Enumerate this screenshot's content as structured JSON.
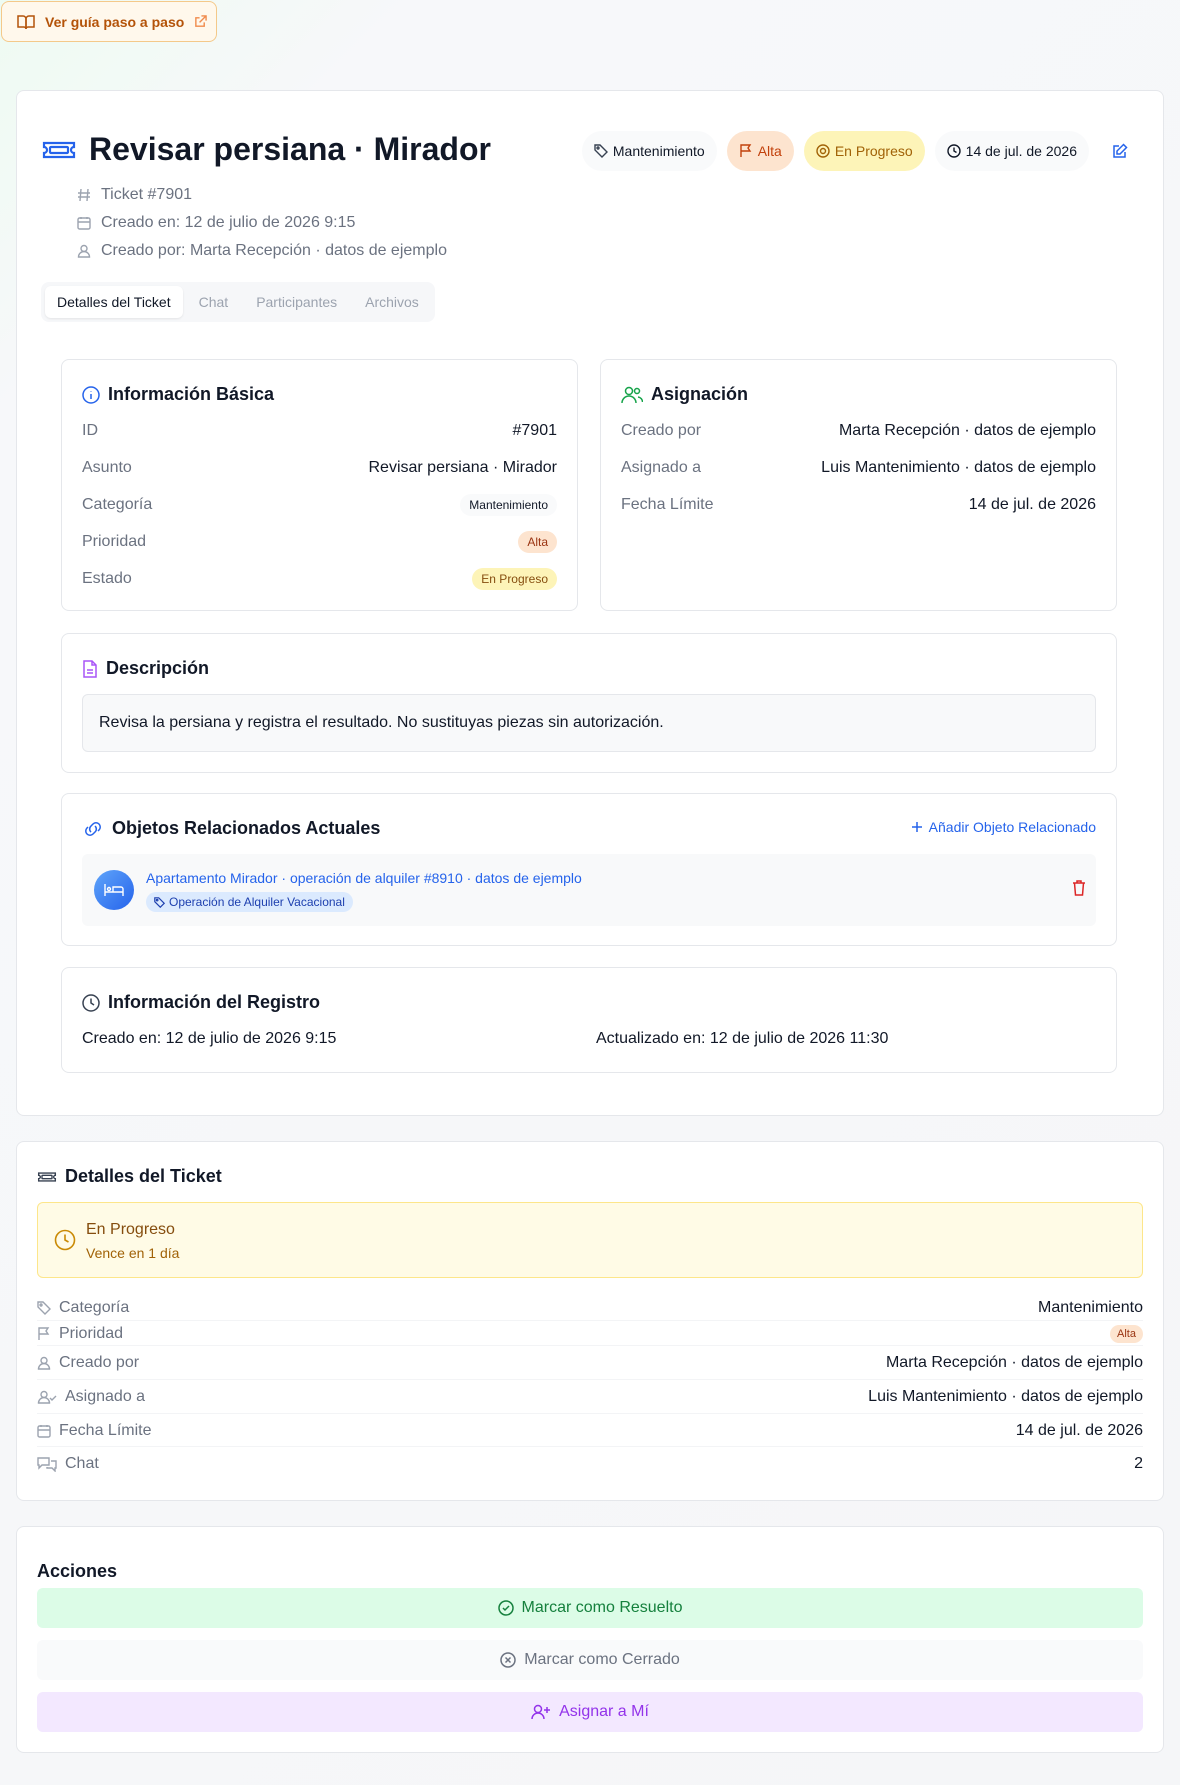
{
  "guide": {
    "label": "Ver guía paso a paso"
  },
  "ticket": {
    "title": "Revisar persiana · Mirador",
    "badges": {
      "category": "Mantenimiento",
      "priority": "Alta",
      "status": "En Progreso",
      "due": "14 de jul. de 2026"
    },
    "meta": {
      "number": "Ticket #7901",
      "created": "Creado en: 12 de julio de 2026 9:15",
      "creator": "Creado por: Marta Recepción · datos de ejemplo"
    }
  },
  "tabs": [
    {
      "label": "Detalles del Ticket"
    },
    {
      "label": "Chat"
    },
    {
      "label": "Participantes"
    },
    {
      "label": "Archivos"
    }
  ],
  "basic_info": {
    "title": "Información Básica",
    "rows": [
      {
        "key": "ID",
        "value": "#7901"
      },
      {
        "key": "Asunto",
        "value": "Revisar persiana · Mirador"
      },
      {
        "key": "Categoría",
        "value": "Mantenimiento"
      },
      {
        "key": "Prioridad",
        "value": "Alta"
      },
      {
        "key": "Estado",
        "value": "En Progreso"
      }
    ]
  },
  "assignment": {
    "title": "Asignación",
    "rows": [
      {
        "key": "Creado por",
        "value": "Marta Recepción · datos de ejemplo"
      },
      {
        "key": "Asignado a",
        "value": "Luis Mantenimiento · datos de ejemplo"
      },
      {
        "key": "Fecha Límite",
        "value": "14 de jul. de 2026"
      }
    ]
  },
  "description": {
    "title": "Descripción",
    "text": "Revisa la persiana y registra el resultado. No sustituyas piezas sin autorización."
  },
  "related": {
    "title": "Objetos Relacionados Actuales",
    "add_label": "Añadir Objeto Relacionado",
    "items": [
      {
        "name": "Apartamento Mirador · operación de alquiler #8910 · datos de ejemplo",
        "type": "Operación de Alquiler Vacacional"
      }
    ]
  },
  "registry": {
    "title": "Información del Registro",
    "created": "Creado en: 12 de julio de 2026 9:15",
    "updated": "Actualizado en: 12 de julio de 2026 11:30"
  },
  "details": {
    "title": "Detalles del Ticket",
    "status": "En Progreso",
    "due_note": "Vence en 1 día",
    "rows": [
      {
        "key": "Categoría",
        "value": "Mantenimiento"
      },
      {
        "key": "Prioridad",
        "value": "Alta"
      },
      {
        "key": "Creado por",
        "value": "Marta Recepción · datos de ejemplo"
      },
      {
        "key": "Asignado a",
        "value": "Luis Mantenimiento · datos de ejemplo"
      },
      {
        "key": "Fecha Límite",
        "value": "14 de jul. de 2026"
      },
      {
        "key": "Chat",
        "value": "2"
      }
    ]
  },
  "actions": {
    "title": "Acciones",
    "resolve": "Marcar como Resuelto",
    "close": "Marcar como Cerrado",
    "assign_me": "Asignar a Mí"
  },
  "colors": {
    "accent_blue": "#2563eb",
    "priority_high": "#fde4cf",
    "status_progress": "#fdf4b8",
    "resolve_green": "#dcfce7",
    "assign_purple": "#f3e8ff"
  }
}
